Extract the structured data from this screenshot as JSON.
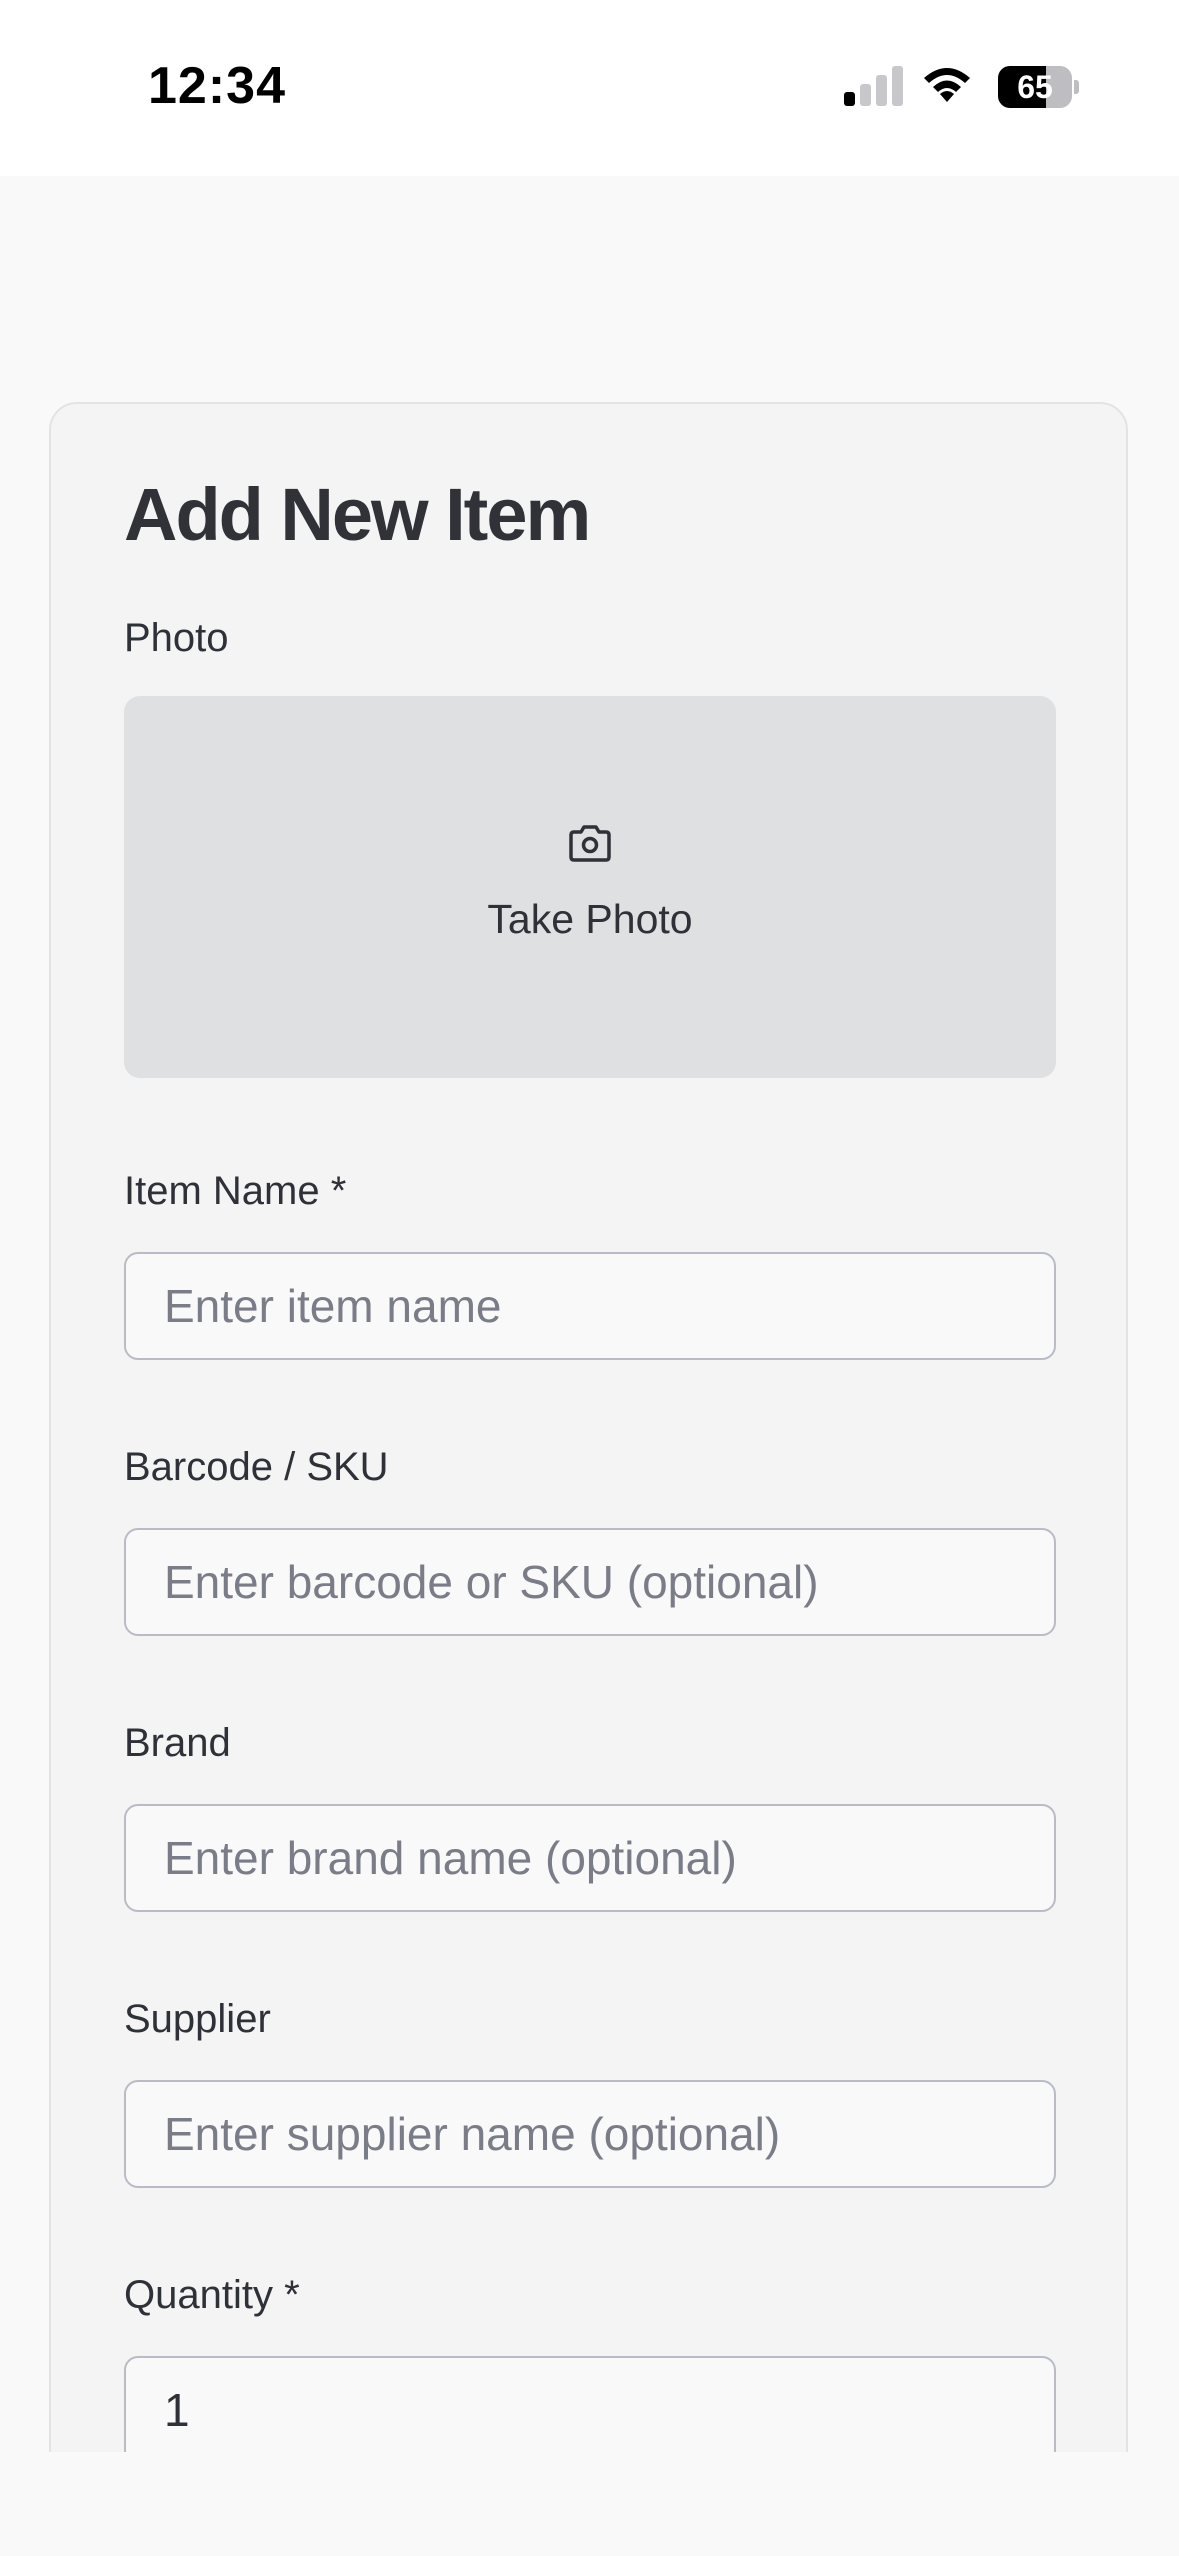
{
  "status_bar": {
    "time": "12:34",
    "battery_level": "65",
    "signal_bars_active": 1,
    "signal_bars_total": 4
  },
  "form": {
    "title": "Add New Item",
    "photo": {
      "label": "Photo",
      "button_label": "Take Photo",
      "icon": "camera-icon"
    },
    "item_name": {
      "label": "Item Name *",
      "placeholder": "Enter item name",
      "value": ""
    },
    "barcode": {
      "label": "Barcode / SKU",
      "placeholder": "Enter barcode or SKU (optional)",
      "value": ""
    },
    "brand": {
      "label": "Brand",
      "placeholder": "Enter brand name (optional)",
      "value": ""
    },
    "supplier": {
      "label": "Supplier",
      "placeholder": "Enter supplier name (optional)",
      "value": ""
    },
    "quantity": {
      "label": "Quantity *",
      "value": "1"
    }
  },
  "colors": {
    "card_background": "#f4f4f5",
    "input_border": "#b9bbc6",
    "photo_background": "#dfe0e2",
    "text": "#2f3138",
    "placeholder": "#7a7d88"
  }
}
